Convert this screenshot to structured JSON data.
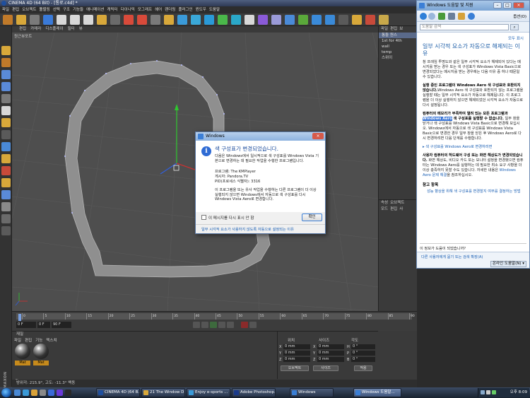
{
  "c4d": {
    "title": "CINEMA 4D (64 Bit) - [통로.c4d] *",
    "menus": [
      "파일",
      "편집",
      "오브젝트",
      "툴렬링",
      "선택",
      "구조",
      "기능들",
      "애니메이션",
      "캐릭터",
      "다이나믹",
      "모그래프",
      "헤어",
      "렌더링",
      "플러그인",
      "윈도우",
      "도움말"
    ],
    "viewport_menus": [
      "편집",
      "카메라",
      "디스플레이",
      "필터",
      "뷰"
    ],
    "viewport_label": "원근뷰포트",
    "objects": {
      "menus": [
        "파일",
        "편집",
        "보"
      ],
      "items": [
        "통돌 원스",
        "1st for 4th",
        "wall",
        "temp",
        "스위이"
      ]
    },
    "attributes": {
      "tabs": [
        "속성",
        "오브젝트"
      ],
      "menus": [
        "모드",
        "편집",
        "사"
      ]
    },
    "timeline": {
      "ticks": [
        "0",
        "5",
        "10",
        "15",
        "20",
        "25",
        "30",
        "35",
        "40",
        "45",
        "50",
        "55",
        "60",
        "65",
        "70",
        "75",
        "80",
        "85",
        "90"
      ],
      "start_field": "0 F",
      "end_field": "90 F",
      "current_field": "0 F"
    },
    "materials": {
      "header": "재질",
      "menus": [
        "파일",
        "편집",
        "기능",
        "텍스쳐"
      ],
      "swatch_labels": [
        "Mat",
        "Mat"
      ]
    },
    "coordinates": {
      "headers": [
        "위치",
        "사이즈",
        "각도"
      ],
      "rows": [
        {
          "axis": "X",
          "pos": "0 mm",
          "size": "0 mm",
          "rot_axis": "H",
          "rot": "0 °"
        },
        {
          "axis": "Y",
          "pos": "0 mm",
          "size": "0 mm",
          "rot_axis": "P",
          "rot": "0 °"
        },
        {
          "axis": "Z",
          "pos": "0 mm",
          "size": "0 mm",
          "rot_axis": "B",
          "rot": "0 °"
        }
      ],
      "mode_select": "오브젝트",
      "size_select": "사이즈",
      "apply_label": "적용"
    },
    "status": "방위각: 215.9°, 고도: -11.3° 백동",
    "maxon_logo": "MAXON CINEMA 4D"
  },
  "help": {
    "window_title": "Windows 도움말 및 지원",
    "minimize": "–",
    "maximize": "□",
    "close": "×",
    "options_label": "옵션(O)",
    "search_placeholder": "도움말 검색",
    "all_topics": "모두 표시",
    "heading": "일부 시각적 요소가 자동으로 해제되는 이유",
    "p1": "창 프레임 투명도와 같은 일부 시각적 요소가 해제되어 있다는 메시지를 받는 경우 또는 색 구성표가 Windows Vista Basic으로 변경되었다는 메시지를 받는 경우에는 다음 이유 중 하나 때문일 수 있습니다.",
    "p2_bold": "실행 중인 프로그램이 Windows Aero 색 구성표와 호환되지 않습니다.",
    "p2_rest": "Windows Aero 색 구성표와 호환되지 않는 프로그램을 실행할 때는 일부 시각적 요소가 자동으로 해제됩니다. 이 프로그램을 더 이상 실행하지 않으면 해제되었던 시각적 요소가 자동으로 다시 설정됩니다.",
    "p3_bold_a": "컴퓨터의 메모리가 부족하여 열려 있는 모든 프로그램과 ",
    "p3_mark": "Windows Aero",
    "p3_bold_b": " 색 구성표를 실행할 수 없습니다.",
    "p3_rest": " 일부 창을 닫거나 색 구성표를 Windows Vista Basic으로 변경해 보십시오. Windows에서 자동으로 색 구성표를 Windows Vista Basic으로 변경한 경우 일부 창을 닫은 후 Windows Aero로 다시 변경하려면 다음 단계를 수행합니다.",
    "link_change": "색 구성표를 Windows Aero로 변경하려면",
    "p4_bold": "사용자 컴퓨터의 하드웨어 구성 또는 화면 해상도가 변경되었습니다.",
    "p4_rest": " 화면 해상도, 비디오 카드 또는 모니터 설정을 변경했으면 컴퓨터는 Windows Aero를 실행하는 데 필요한 최소 요구 사항을 더 이상 충족하지 못할 수도 있습니다. 자세한 내용은 ",
    "p4_link": "Windows Aero 문제 해결",
    "p4_end": "을 참조하십시오.",
    "see_also": "참고 항목",
    "see_also_item": "성능 향상을 위해 색 구성표를 변경할지 여부를 결정하는 방법",
    "feedback": "이 정보가 도움이 되었습니까?",
    "more_support": "다른 사용자에게 묻기 또는 검색 확장(A)",
    "online_help": "온라인 도움말(N) ▾"
  },
  "dialog": {
    "title": "Windows",
    "heading": "색 구성표가 변경되었습니다.",
    "text1": "다음은 Windows에서 일시적으로 색 구성표를 Windows Vista 기본으로 변경하는 데 필요한 작업을 수행한 프로그램입니다.",
    "program_line": "프로그램: The KMPlayer",
    "publisher_line": "게시자: Pandora.TV",
    "pid_line": "PID(프로세스 식별자): 3316",
    "text2": "이 프로그램을 또는 유사 작업을 수행하는 다른 프로그램이 더 이상 실행되지 않으면 Windows에서 자동으로 색 구성표를 다시 Windows Vista Aero로 변경합니다.",
    "checkbox_label": "이 메시지를 다시 표시 안 함",
    "ok_label": "확인",
    "link": "일부 시각적 요소가 사용하지 않도록 자동으로 설정되는 이유",
    "close_glyph": "×"
  },
  "taskbar": {
    "buttons": [
      "CINEMA 4D (64 B...",
      "21 The Window D...",
      "Enjoy e-sports ...",
      "Adobe Photoshop...",
      "Windows",
      "Windows 도움말..."
    ],
    "clock": "오후 8:09"
  }
}
